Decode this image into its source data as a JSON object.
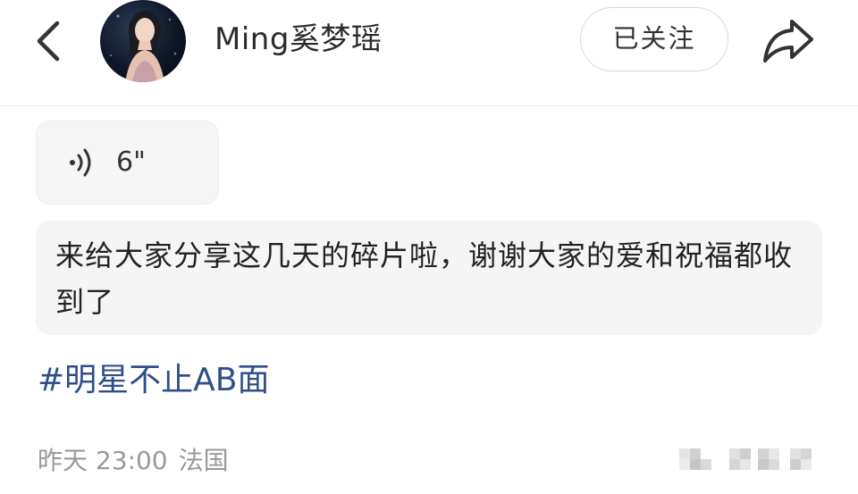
{
  "header": {
    "back_icon": "chevron-left-icon",
    "avatar_alt": "avatar",
    "username": "Ming奚梦瑶",
    "follow_label": "已关注",
    "share_icon": "share-arrow-icon"
  },
  "post": {
    "voice": {
      "icon": "sound-wave-icon",
      "duration": "6\""
    },
    "text": "来给大家分享这几天的碎片啦，谢谢大家的爱和祝福都收到了",
    "hashtag": "#明星不止AB面",
    "meta": {
      "time": "昨天 23:00",
      "location": "法国"
    }
  },
  "colors": {
    "hashtag": "#2f4f8a",
    "meta_text": "#999999",
    "bubble_bg": "#f5f5f5"
  }
}
